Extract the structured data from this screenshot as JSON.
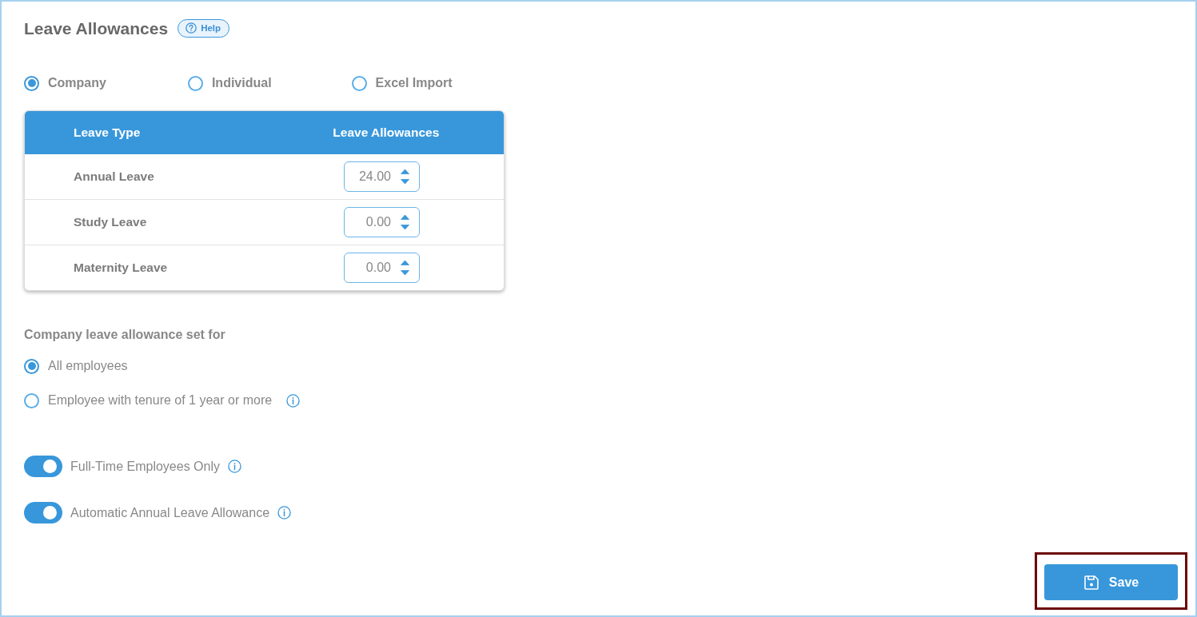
{
  "title": "Leave Allowances",
  "help_button": {
    "label": "Help"
  },
  "source_options": [
    {
      "label": "Company",
      "selected": true
    },
    {
      "label": "Individual",
      "selected": false
    },
    {
      "label": "Excel Import",
      "selected": false
    }
  ],
  "table": {
    "columns": [
      "Leave Type",
      "Leave Allowances"
    ],
    "rows": [
      {
        "leave_type": "Annual Leave",
        "allowance": "24.00"
      },
      {
        "leave_type": "Study Leave",
        "allowance": "0.00"
      },
      {
        "leave_type": "Maternity Leave",
        "allowance": "0.00"
      }
    ]
  },
  "set_for": {
    "heading": "Company leave allowance set for",
    "options": [
      {
        "label": "All employees",
        "selected": true,
        "info": false
      },
      {
        "label": "Employee with tenure of 1 year or more",
        "selected": false,
        "info": true
      }
    ]
  },
  "toggles": [
    {
      "label": "Full-Time Employees Only",
      "on": true,
      "info": true
    },
    {
      "label": "Automatic Annual Leave Allowance",
      "on": true,
      "info": true
    }
  ],
  "save_button": {
    "label": "Save",
    "highlighted": true
  }
}
